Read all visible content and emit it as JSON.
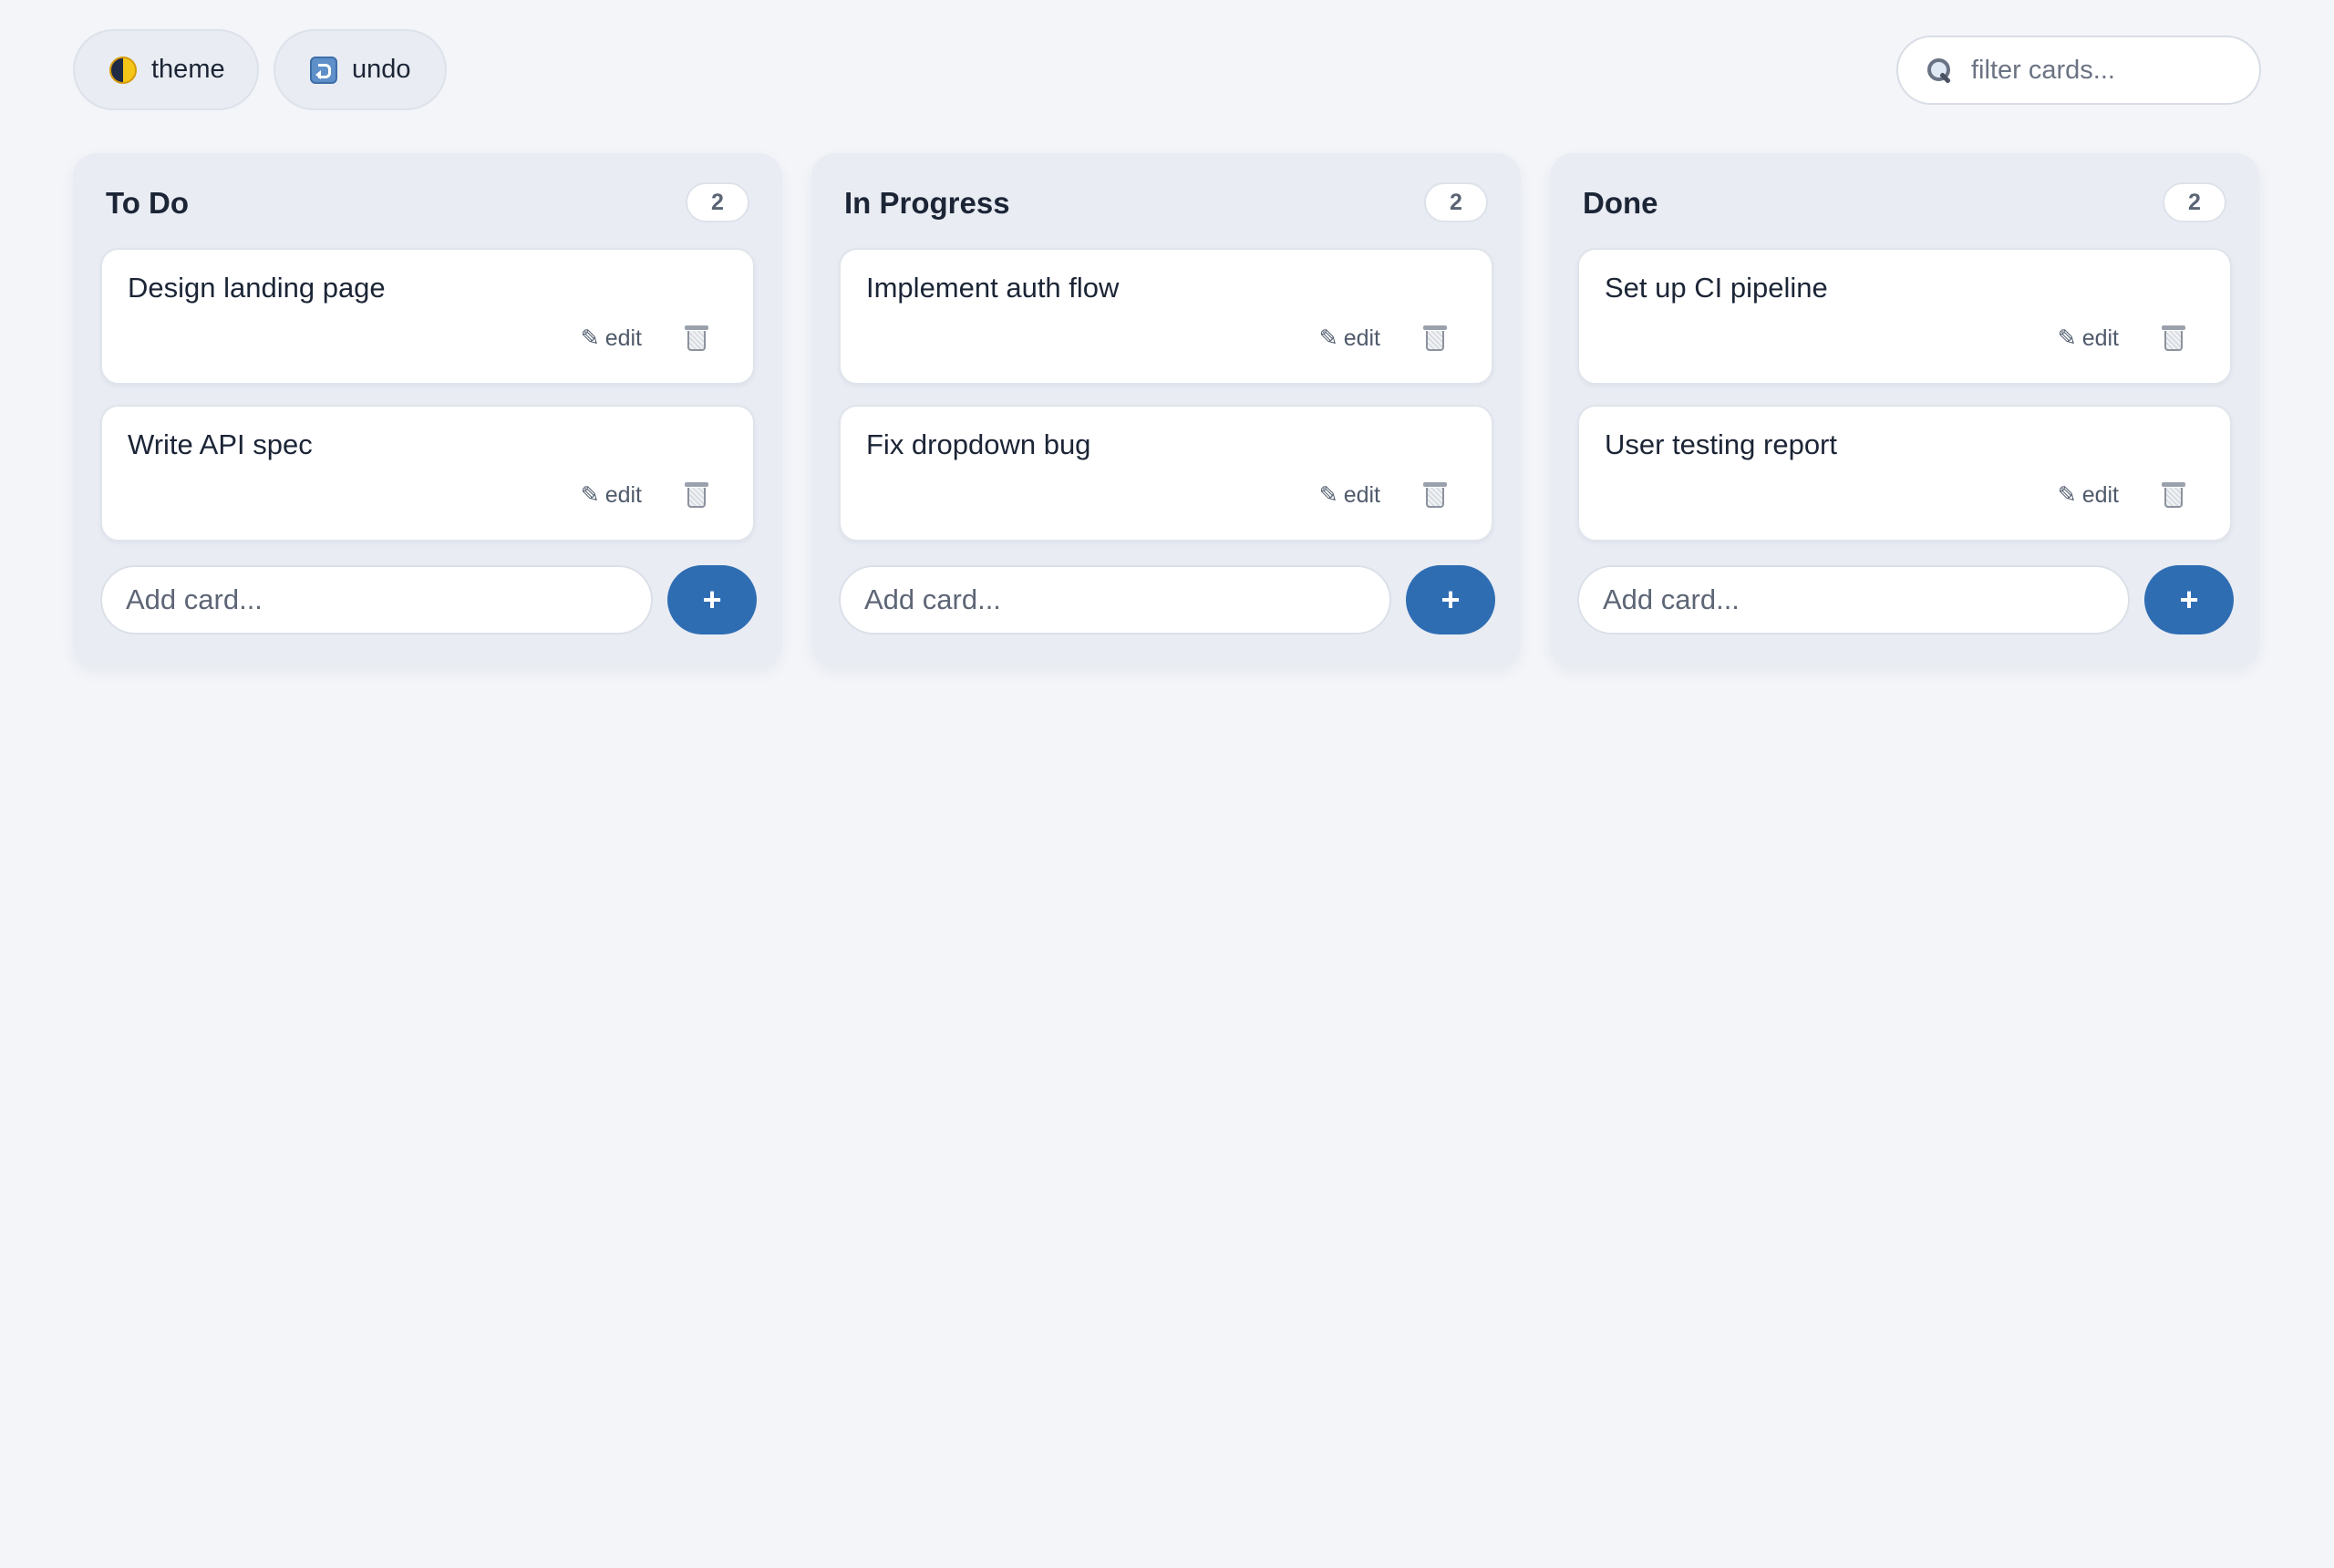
{
  "toolbar": {
    "theme_label": "theme",
    "theme_icon": "half-moon-theme-icon",
    "undo_label": "undo",
    "undo_icon": "undo-arrow-icon",
    "filter_placeholder": "filter cards...",
    "filter_icon": "search-icon"
  },
  "columns": [
    {
      "title": "To Do",
      "count": "2",
      "cards": [
        {
          "text": "Design landing page",
          "edit_label": "edit"
        },
        {
          "text": "Write API spec",
          "edit_label": "edit"
        }
      ],
      "add_placeholder": "Add card...",
      "add_button_label": "+"
    },
    {
      "title": "In Progress",
      "count": "2",
      "cards": [
        {
          "text": "Implement auth flow",
          "edit_label": "edit"
        },
        {
          "text": "Fix dropdown bug",
          "edit_label": "edit"
        }
      ],
      "add_placeholder": "Add card...",
      "add_button_label": "+"
    },
    {
      "title": "Done",
      "count": "2",
      "cards": [
        {
          "text": "Set up CI pipeline",
          "edit_label": "edit"
        },
        {
          "text": "User testing report",
          "edit_label": "edit"
        }
      ],
      "add_placeholder": "Add card...",
      "add_button_label": "+"
    }
  ],
  "colors": {
    "background": "#f3f5f9",
    "column_background": "#e9ecf3",
    "accent": "#2f6db3",
    "text": "#1c2536"
  }
}
